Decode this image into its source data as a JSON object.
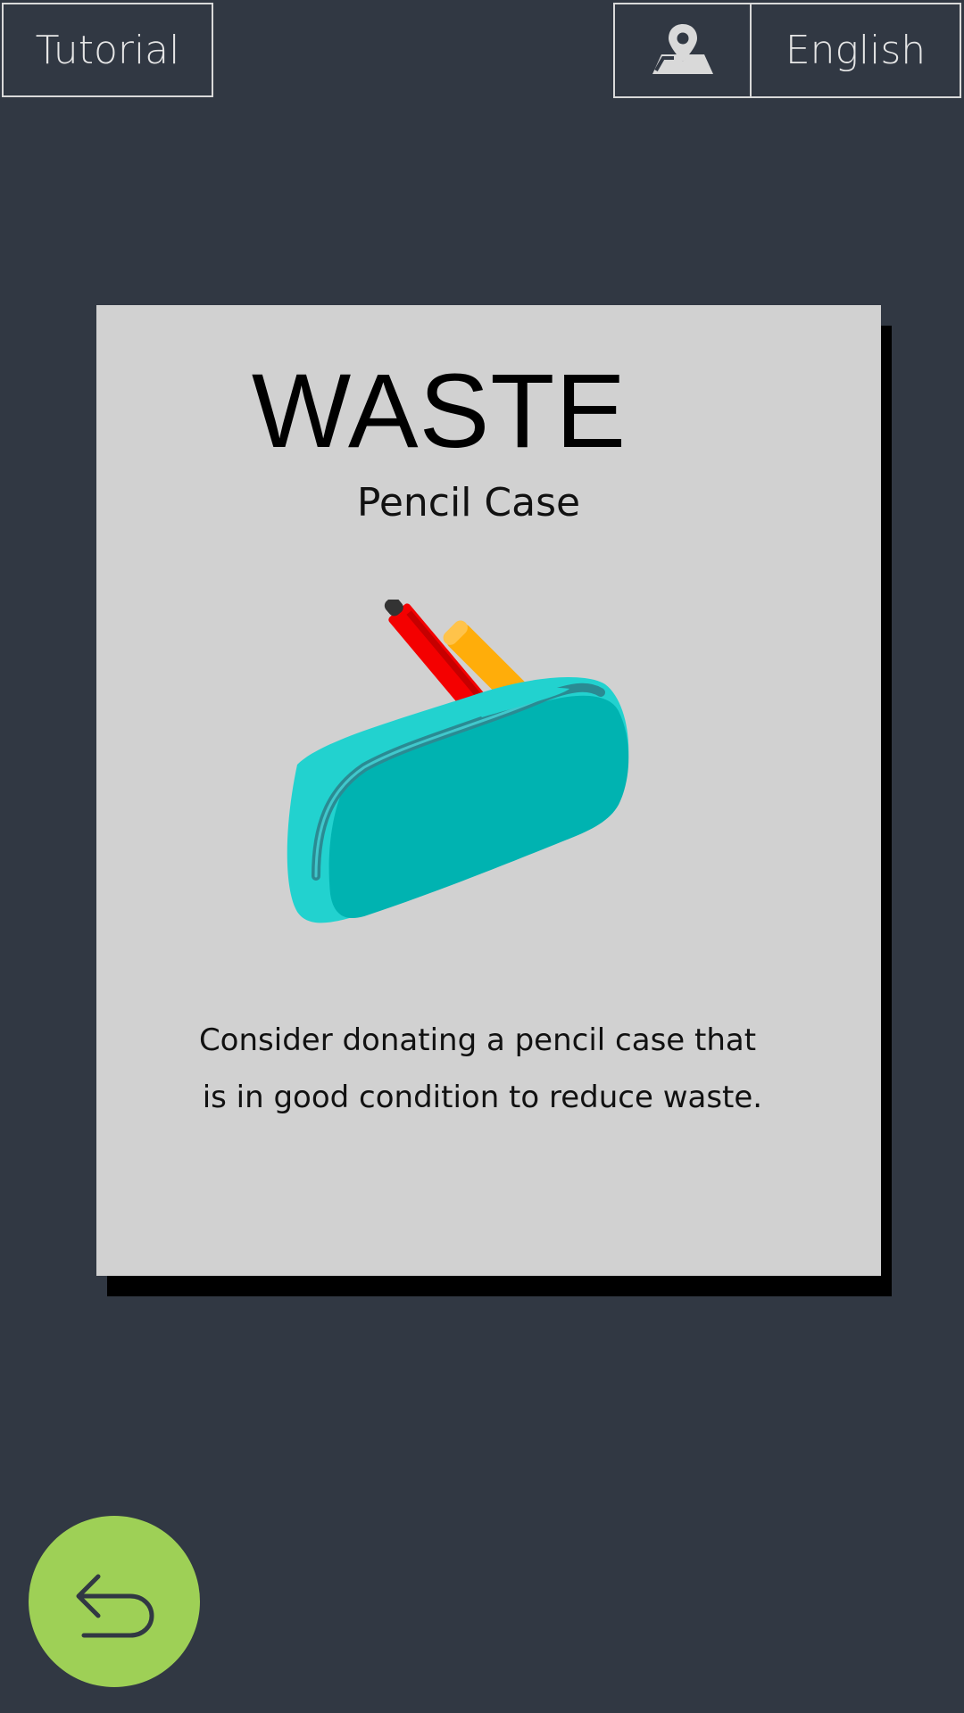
{
  "header": {
    "tutorial_label": "Tutorial",
    "location_icon": "map-pin-icon",
    "language_label": "English"
  },
  "card": {
    "title": "WASTE",
    "subtitle": "Pencil Case",
    "image": "pencil-case-illustration",
    "description_line1": "Consider donating a pencil case that",
    "description_line2": " is in good condition to reduce waste."
  },
  "footer": {
    "back_icon": "undo-arrow-icon"
  },
  "colors": {
    "background": "#313843",
    "card": "#d1d1d1",
    "back_button": "#9ed056",
    "pencil_case": "#1fc6c4"
  }
}
